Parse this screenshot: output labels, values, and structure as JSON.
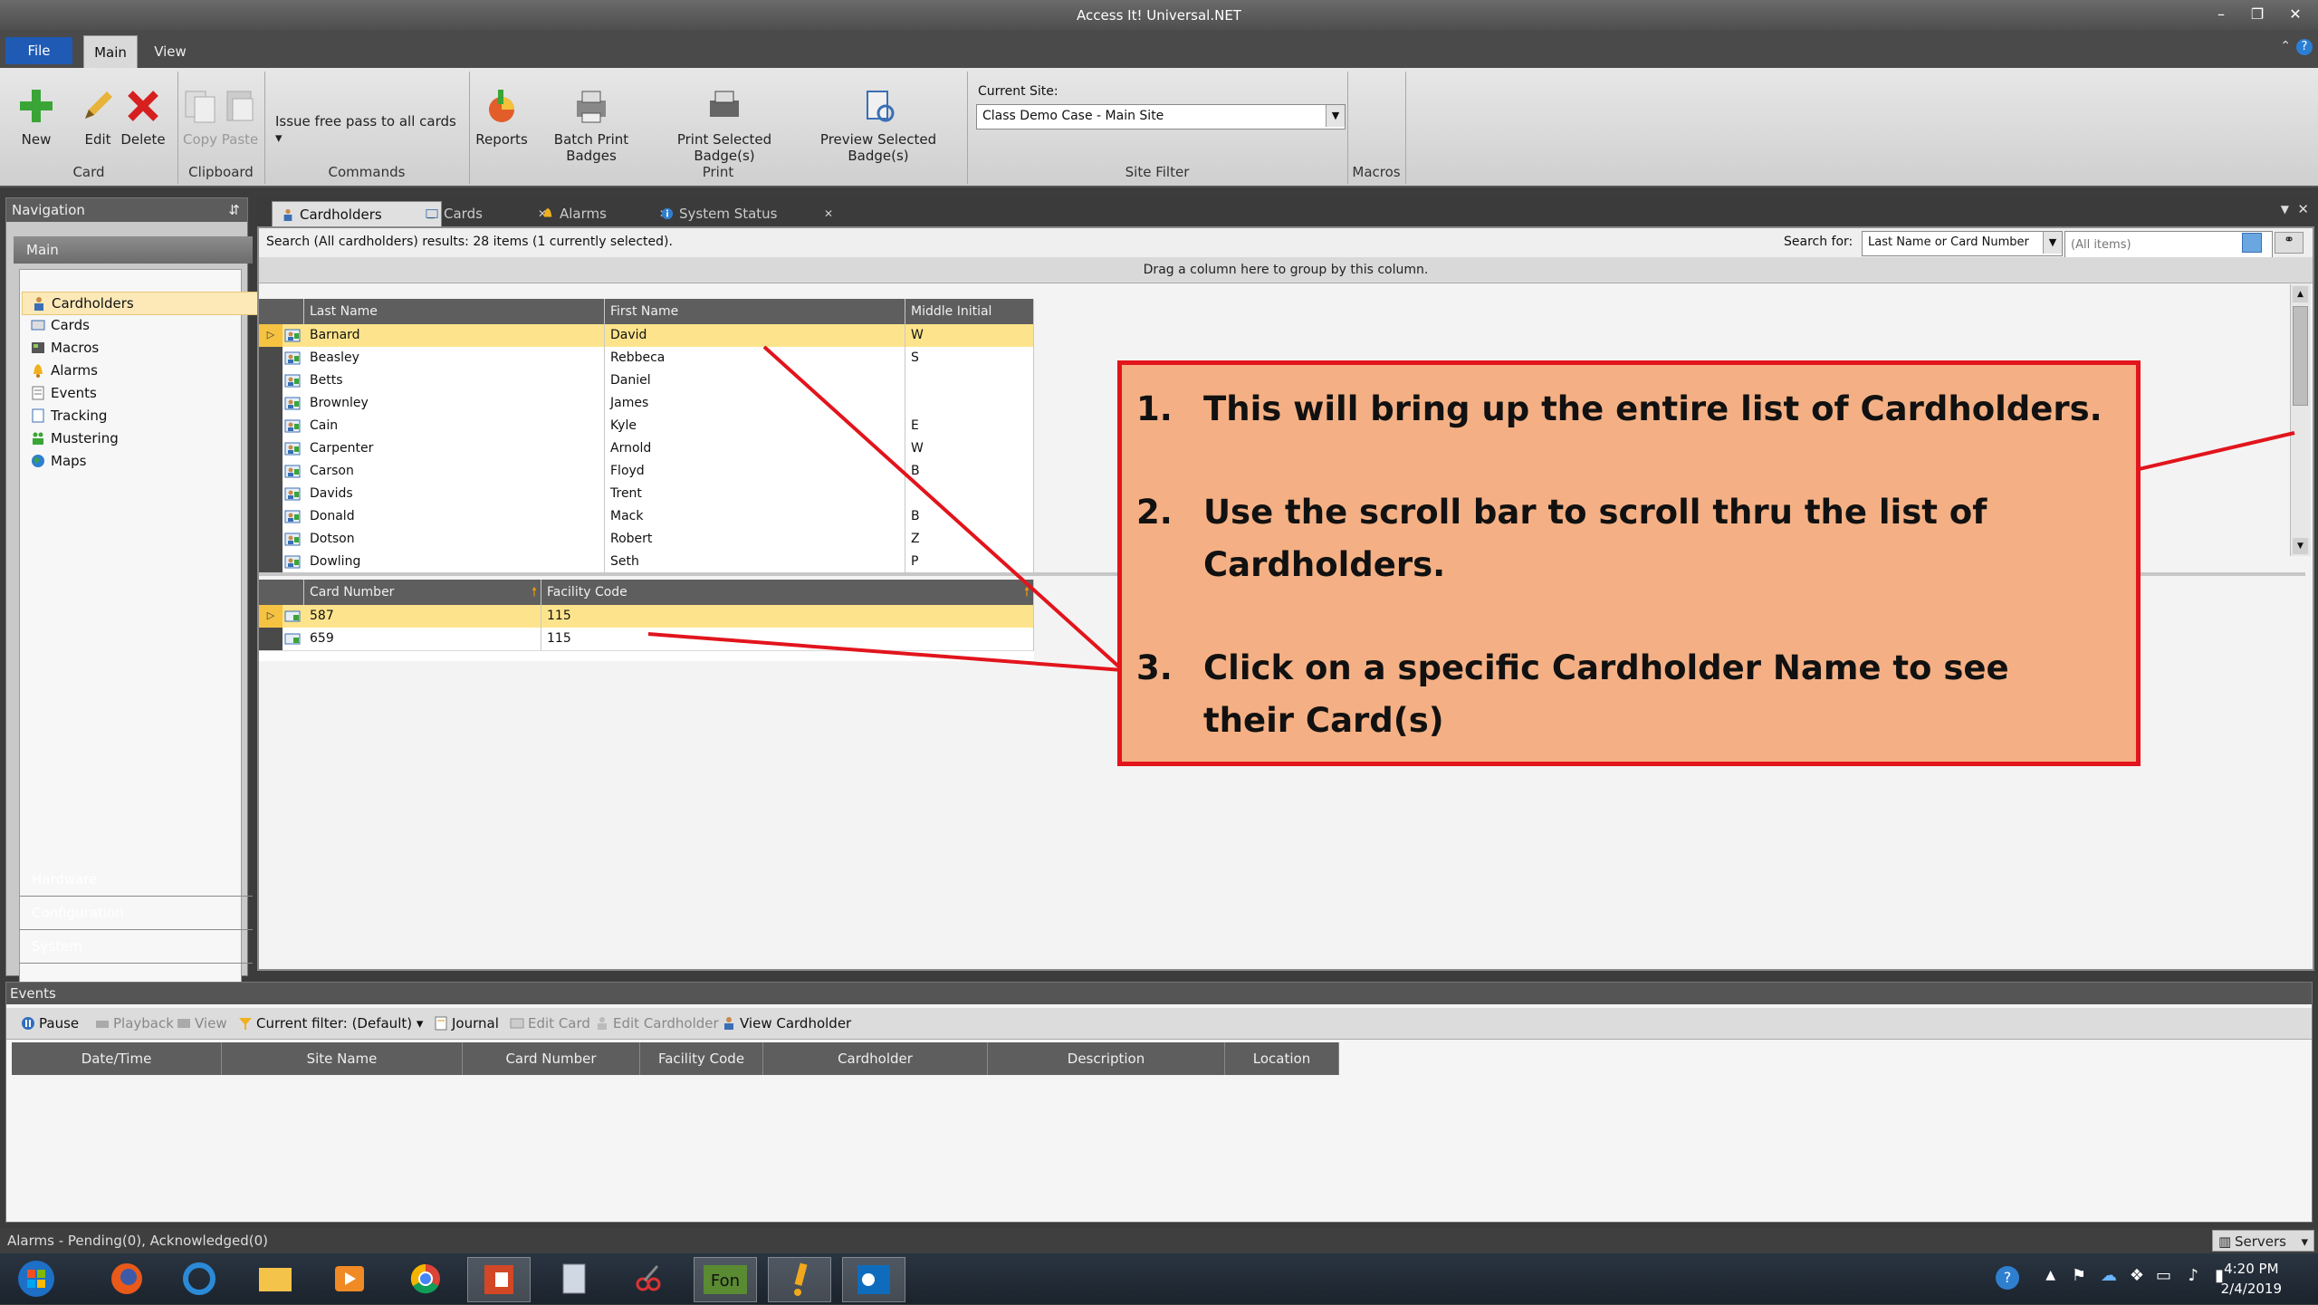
{
  "window": {
    "title": "Access It! Universal.NET"
  },
  "ribbon_tabs": [
    "File",
    "Main",
    "View"
  ],
  "ribbon": {
    "card_group": {
      "title": "Card",
      "new": "New",
      "edit": "Edit",
      "delete": "Delete"
    },
    "clipboard_group": {
      "title": "Clipboard",
      "copy": "Copy",
      "paste": "Paste"
    },
    "commands_group": {
      "title": "Commands",
      "issue_free_pass": "Issue free pass to all cards"
    },
    "print_group": {
      "title": "Print",
      "reports": "Reports",
      "batch_print": "Batch Print Badges",
      "print_selected": "Print Selected Badge(s)",
      "preview_selected": "Preview Selected Badge(s)"
    },
    "site_filter_group": {
      "title": "Site Filter",
      "current_site_label": "Current Site:",
      "current_site_value": "Class Demo Case - Main Site"
    },
    "macros_group": {
      "title": "Macros"
    }
  },
  "navigation": {
    "header": "Navigation",
    "section_main": "Main",
    "items": [
      "Cardholders",
      "Cards",
      "Macros",
      "Alarms",
      "Events",
      "Tracking",
      "Mustering",
      "Maps"
    ],
    "selected": "Cardholders",
    "sections": [
      "Hardware",
      "Configuration",
      "System"
    ]
  },
  "doc_tabs": [
    "Cardholders",
    "Cards",
    "Alarms",
    "System Status"
  ],
  "search": {
    "summary": "Search (All cardholders) results: 28 items (1 currently selected).",
    "search_for_label": "Search for:",
    "search_field": "Last Name or Card Number",
    "placeholder": "(All items)"
  },
  "group_hint": "Drag a column here to group by this column.",
  "cardholders": {
    "columns": [
      "Last Name",
      "First Name",
      "Middle Initial"
    ],
    "rows": [
      [
        "Barnard",
        "David",
        "W"
      ],
      [
        "Beasley",
        "Rebbeca",
        "S"
      ],
      [
        "Betts",
        "Daniel",
        ""
      ],
      [
        "Brownley",
        "James",
        ""
      ],
      [
        "Cain",
        "Kyle",
        "E"
      ],
      [
        "Carpenter",
        "Arnold",
        "W"
      ],
      [
        "Carson",
        "Floyd",
        "B"
      ],
      [
        "Davids",
        "Trent",
        ""
      ],
      [
        "Donald",
        "Mack",
        "B"
      ],
      [
        "Dotson",
        "Robert",
        "Z"
      ],
      [
        "Dowling",
        "Seth",
        "P"
      ]
    ]
  },
  "cards": {
    "columns": [
      "Card Number",
      "Facility Code"
    ],
    "rows": [
      [
        "587",
        "115"
      ],
      [
        "659",
        "115"
      ]
    ]
  },
  "callout": {
    "steps": [
      {
        "num": "1.",
        "text": "This will bring up the entire list of Cardholders."
      },
      {
        "num": "2.",
        "text": "Use the scroll bar to scroll thru the list of Cardholders."
      },
      {
        "num": "3.",
        "text": "Click on a specific Cardholder Name to see their Card(s)"
      }
    ],
    "colors": {
      "fill": "#f4b084",
      "border": "#e2141c"
    }
  },
  "events": {
    "header": "Events",
    "toolbar": [
      "Pause",
      "Playback",
      "View",
      "Current filter:",
      "(Default)",
      "Journal",
      "Edit Card",
      "Edit Cardholder",
      "View Cardholder"
    ],
    "columns": [
      "Date/Time",
      "Site Name",
      "Card Number",
      "Facility Code",
      "Cardholder",
      "Description",
      "Location"
    ]
  },
  "status": {
    "alarms": "Alarms - Pending(0), Acknowledged(0)",
    "servers": "Servers"
  },
  "taskbar": {
    "time": "4:20 PM",
    "date": "2/4/2019"
  }
}
